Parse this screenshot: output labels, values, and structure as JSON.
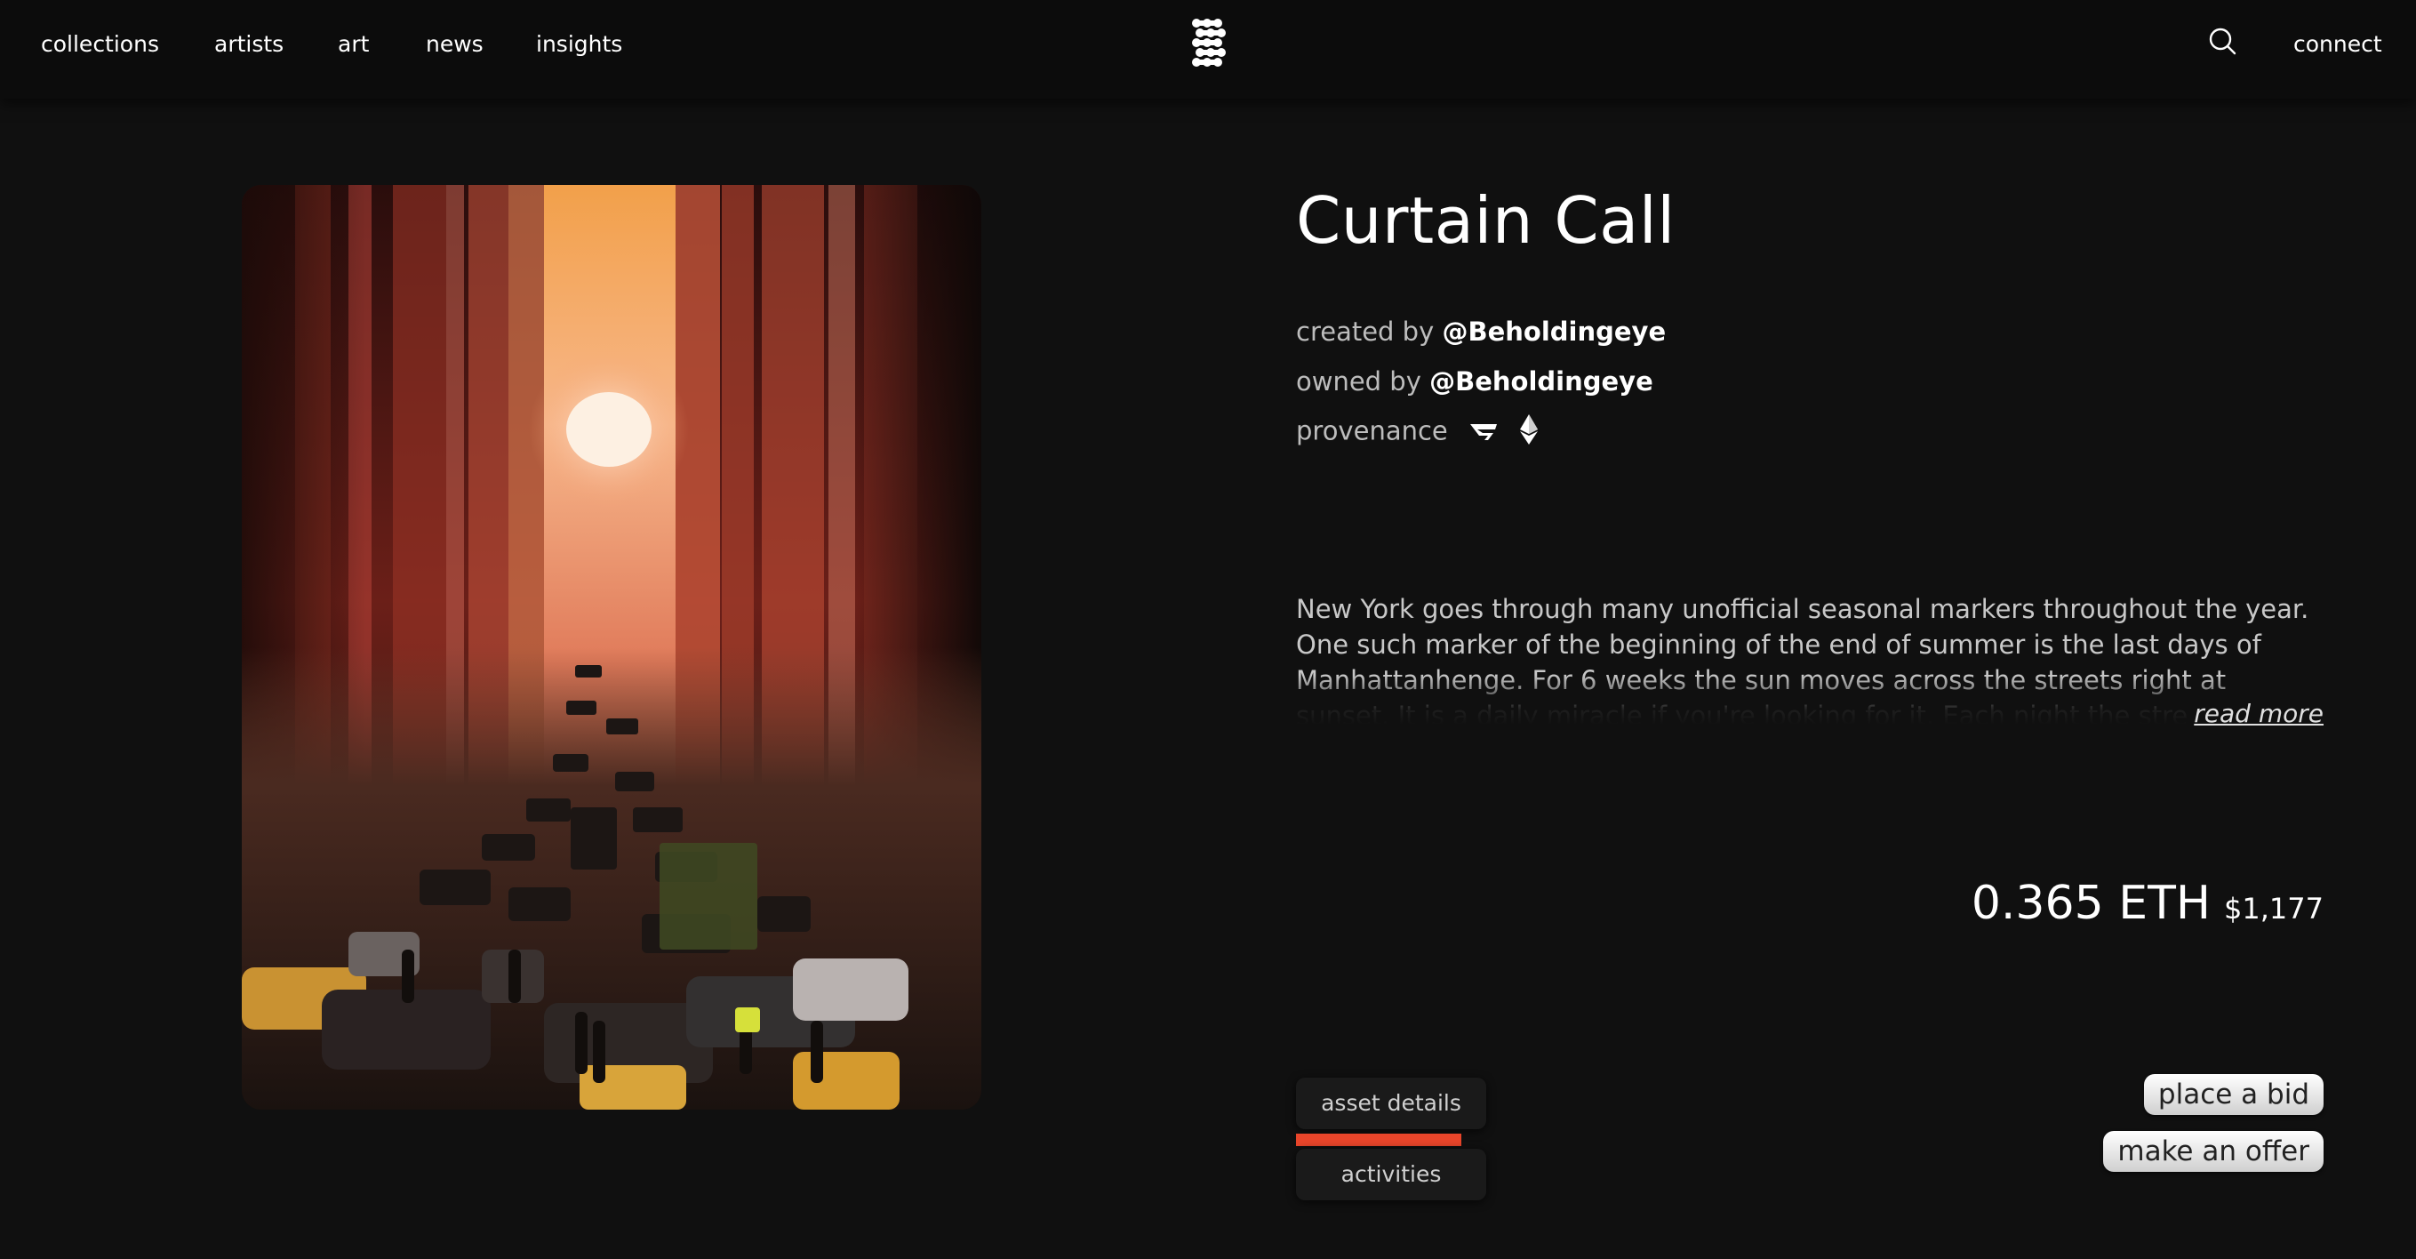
{
  "nav": {
    "items": [
      {
        "label": "collections"
      },
      {
        "label": "artists"
      },
      {
        "label": "art"
      },
      {
        "label": "news"
      },
      {
        "label": "insights"
      }
    ],
    "logo_icon": "dotted-squiggle-logo-icon",
    "search_icon": "search-icon",
    "connect_label": "connect"
  },
  "artwork": {
    "kind": "photograph of Manhattanhenge sunset over a busy avenue"
  },
  "asset": {
    "title": "Curtain Call",
    "created_prefix": "created by",
    "creator": "@Beholdingeye",
    "owned_prefix": "owned by",
    "owner": "@Beholdingeye",
    "provenance_label": "provenance",
    "provenance_icons": [
      "marketplace-icon",
      "ethereum-icon"
    ],
    "description": "New York goes through many unofficial seasonal markers throughout the year. One such marker of the beginning of the end of summer is the last days of Manhattanhenge. For 6 weeks the sun moves across the streets right at sunset. It is a daily miracle if you're looking for it. Each night the streets get flooded",
    "read_more": "read more",
    "price_eth": "0.365 ETH",
    "price_usd": "$1,177"
  },
  "tabs": {
    "asset_details": "asset details",
    "activities": "activities",
    "active": "asset details",
    "accent_color": "#e8452a"
  },
  "actions": {
    "place_bid": "place a bid",
    "make_offer": "make an offer"
  }
}
